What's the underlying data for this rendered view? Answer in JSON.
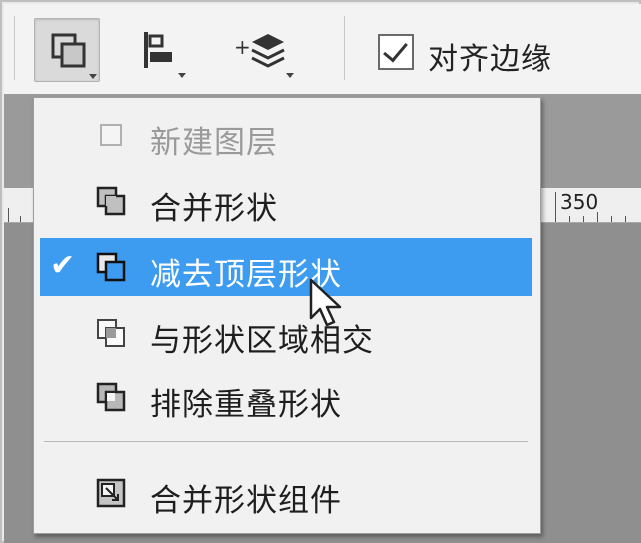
{
  "toolbar": {
    "buttons": [
      {
        "icon": "path-operations-icon",
        "pressed": true
      },
      {
        "icon": "path-alignment-icon",
        "pressed": false
      },
      {
        "icon": "path-arrangement-icon",
        "pressed": false
      }
    ],
    "align_edges": {
      "label": "对齐边缘",
      "checked": true
    }
  },
  "ruler": {
    "label": "350"
  },
  "menu": {
    "items": [
      {
        "label": "新建图层",
        "icon": "new-layer-icon",
        "state": "disabled",
        "checked": false
      },
      {
        "label": "合并形状",
        "icon": "combine-shapes-icon",
        "state": "normal",
        "checked": false
      },
      {
        "label": "减去顶层形状",
        "icon": "subtract-front-shape-icon",
        "state": "highlighted",
        "checked": true
      },
      {
        "label": "与形状区域相交",
        "icon": "intersect-shape-areas-icon",
        "state": "normal",
        "checked": false
      },
      {
        "label": "排除重叠形状",
        "icon": "exclude-overlapping-shapes-icon",
        "state": "normal",
        "checked": false
      },
      {
        "label": "合并形状组件",
        "icon": "merge-shape-components-icon",
        "state": "normal",
        "checked": false
      }
    ]
  },
  "colors": {
    "highlight": "#3d9bf0",
    "menu_bg": "#f1f1f1",
    "workspace": "#8f8f8f"
  }
}
